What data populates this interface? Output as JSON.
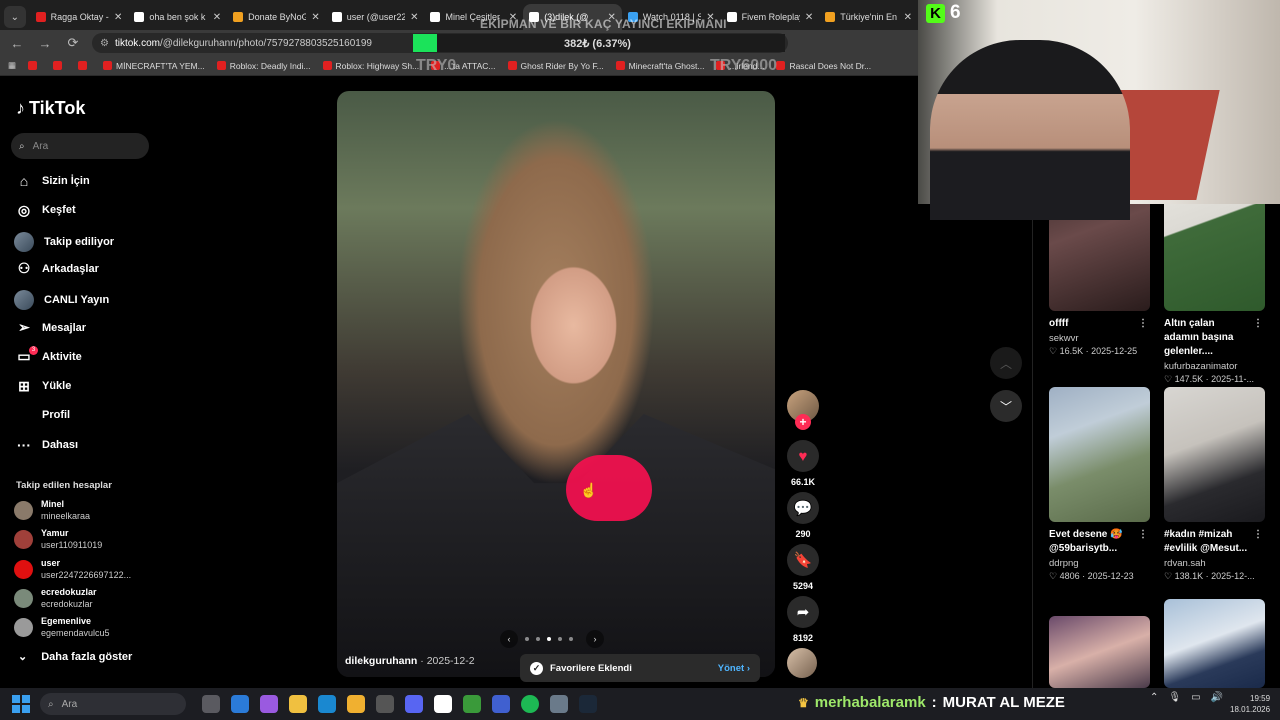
{
  "browser": {
    "tabs": [
      {
        "label": "Ragga Oktay -",
        "color": "#e02020",
        "active": false
      },
      {
        "label": "oha ben şok k",
        "color": "#ffffff",
        "active": false
      },
      {
        "label": "Donate ByNoG",
        "color": "#f0a020",
        "active": false
      },
      {
        "label": "user (@user22",
        "color": "#ffffff",
        "active": false
      },
      {
        "label": "Minel Çeşitler",
        "color": "#ffffff",
        "active": false
      },
      {
        "label": "(3)dilek (@",
        "color": "#ffffff",
        "active": true
      },
      {
        "label": "Watch 0118 | S",
        "color": "#3aa0f0",
        "active": false
      },
      {
        "label": "Fivem Roleplay",
        "color": "#ffffff",
        "active": false
      },
      {
        "label": "Türkiye'nin En",
        "color": "#f0a020",
        "active": false
      }
    ],
    "url_domain": "tiktok.com",
    "url_path": "/@dilekguruhann/photo/7579278803525160199",
    "bookmarks": [
      "",
      "",
      "",
      "MİNECRAFT'TA YEM...",
      "Roblox: Deadly Indi...",
      "Roblox: Highway Sh...",
      "...'ta ATTAC...",
      "Ghost Rider By Yo F...",
      "Minecraft'ta Ghost...",
      "...irlend...",
      "Rascal Does Not Dr..."
    ]
  },
  "overlay": {
    "title": "EKİPMAN VE BİR KAÇ YAYINCI EKİPMANI",
    "progress_text": "382₺ (6.37%)",
    "progress_fraction": 0.0637,
    "min_label": "TRY0",
    "max_label": "TRY6000",
    "fill_color": "#1be35a"
  },
  "sidebar": {
    "logo": "TikTok",
    "search_placeholder": "Ara",
    "nav": [
      {
        "label": "Sizin İçin",
        "icon": "home-icon"
      },
      {
        "label": "Keşfet",
        "icon": "compass-icon"
      },
      {
        "label": "Takip ediliyor",
        "icon": "avatar"
      },
      {
        "label": "Arkadaşlar",
        "icon": "friends-icon"
      },
      {
        "label": "CANLI Yayın",
        "icon": "avatar"
      },
      {
        "label": "Mesajlar",
        "icon": "send-icon"
      },
      {
        "label": "Aktivite",
        "icon": "message-icon"
      },
      {
        "label": "Yükle",
        "icon": "plus-square-icon"
      },
      {
        "label": "Profil",
        "icon": ""
      },
      {
        "label": "Dahası",
        "icon": "more-icon"
      }
    ],
    "activity_badge": "3",
    "following_title": "Takip edilen hesaplar",
    "accounts": [
      {
        "name": "Minel",
        "handle": "mineelkaraa",
        "color": "#8a7a6a"
      },
      {
        "name": "Yamur",
        "handle": "user110911019",
        "color": "#a0403a"
      },
      {
        "name": "user",
        "handle": "user2247226697122...",
        "color": "#e01010"
      },
      {
        "name": "ecredokuzlar",
        "handle": "ecredokuzlar",
        "color": "#7a8a7a"
      },
      {
        "name": "Egemenlive",
        "handle": "egemendavulcu5",
        "color": "#9a9a9a"
      }
    ],
    "show_more": "Daha fazla göster"
  },
  "post": {
    "author": "dilekguruhann",
    "date": "2025-12-2",
    "likes": "66.1K",
    "comments": "290",
    "saves": "5294",
    "shares": "8192",
    "toast_title": "Favorilere Eklendi",
    "toast_action": "Yönet"
  },
  "webcam": {
    "kick_count": "6"
  },
  "recommended": [
    {
      "title": "offff",
      "author": "sekwvr",
      "likes": "16.5K",
      "date": "2025-12-25",
      "bg": "linear-gradient(160deg,#3a2a2a,#6a4a4a 40%,#2a1c1c)"
    },
    {
      "title": "Altın çalan adamın başına gelenler....",
      "author": "kufurbazanimator",
      "likes": "147.5K",
      "date": "2025-11-...",
      "bg": "linear-gradient(160deg,#e8e6e0 0%,#dcdad4 35%,#3f6b3a 36%,#2f5a2c 100%)"
    },
    {
      "title": "Evet desene 🥵 @59barisytb...",
      "author": "ddrpng",
      "likes": "4806",
      "date": "2025-12-23",
      "bg": "linear-gradient(160deg,#9fb0c4 0%,#c0cdd8 30%,#7a8d6a 60%,#5a6b4a 100%)"
    },
    {
      "title": "#kadın #mizah #evlilik @Mesut...",
      "author": "rdvan.sah",
      "likes": "138.1K",
      "date": "2025-12-...",
      "bg": "linear-gradient(160deg,#d8d6d2 0%,#c6c2bc 40%,#2a2a2e 70%,#1a1a1e 100%)"
    },
    {
      "title": "",
      "author": "",
      "likes": "",
      "date": "",
      "bg": "linear-gradient(160deg,#6a4a6a,#d8b0a8 50%,#4a3a4a)"
    },
    {
      "title": "",
      "author": "",
      "likes": "",
      "date": "",
      "bg": "linear-gradient(160deg,#a8c0d8,#dfe6ee 45%,#2a3a5a 70%,#1a2a4a)"
    }
  ],
  "taskbar": {
    "search_placeholder": "Ara",
    "chat_user": "merhabalaramk",
    "chat_sep": ":",
    "chat_text": "MURAT AL MEZE",
    "time": "19:59",
    "date": "18.01.2026"
  }
}
